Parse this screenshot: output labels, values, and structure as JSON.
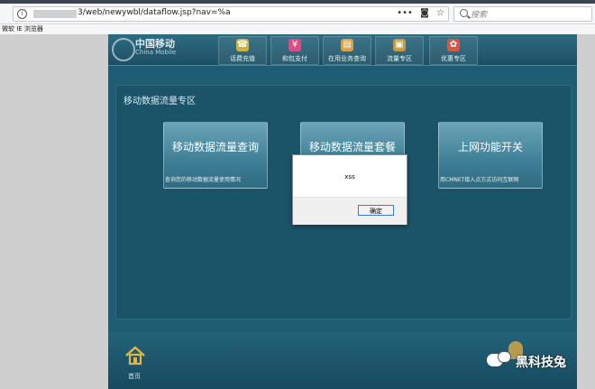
{
  "browser": {
    "url_suffix": "3/web/newywbl/dataflow.jsp?nav=%a",
    "search_placeholder": "搜索",
    "bookmark": "微软 IE 浏览器",
    "more_icon": "•••"
  },
  "site": {
    "logo_cn": "中国移动",
    "logo_en": "China Mobile",
    "nav": [
      {
        "label": "话费充值",
        "icon_color": "#c9b347"
      },
      {
        "label": "和包支付",
        "icon_color": "#d64f86"
      },
      {
        "label": "在用业务查询",
        "icon_color": "#d9a24a"
      },
      {
        "label": "流量专区",
        "icon_color": "#c59a47"
      },
      {
        "label": "优惠专区",
        "icon_color": "#d05a4a"
      }
    ],
    "panel_title": "移动数据流量专区",
    "cards": [
      {
        "title": "移动数据流量查询",
        "desc": "查询您的移动数据流量使用情况"
      },
      {
        "title": "移动数据流量套餐",
        "desc": ""
      },
      {
        "title": "上网功能开关",
        "desc": "用CMNET接入点方式访问互联网"
      }
    ],
    "home_label": "首页"
  },
  "dialog": {
    "message": "xss",
    "ok_label": "确定"
  },
  "watermark": "黑科技兔"
}
